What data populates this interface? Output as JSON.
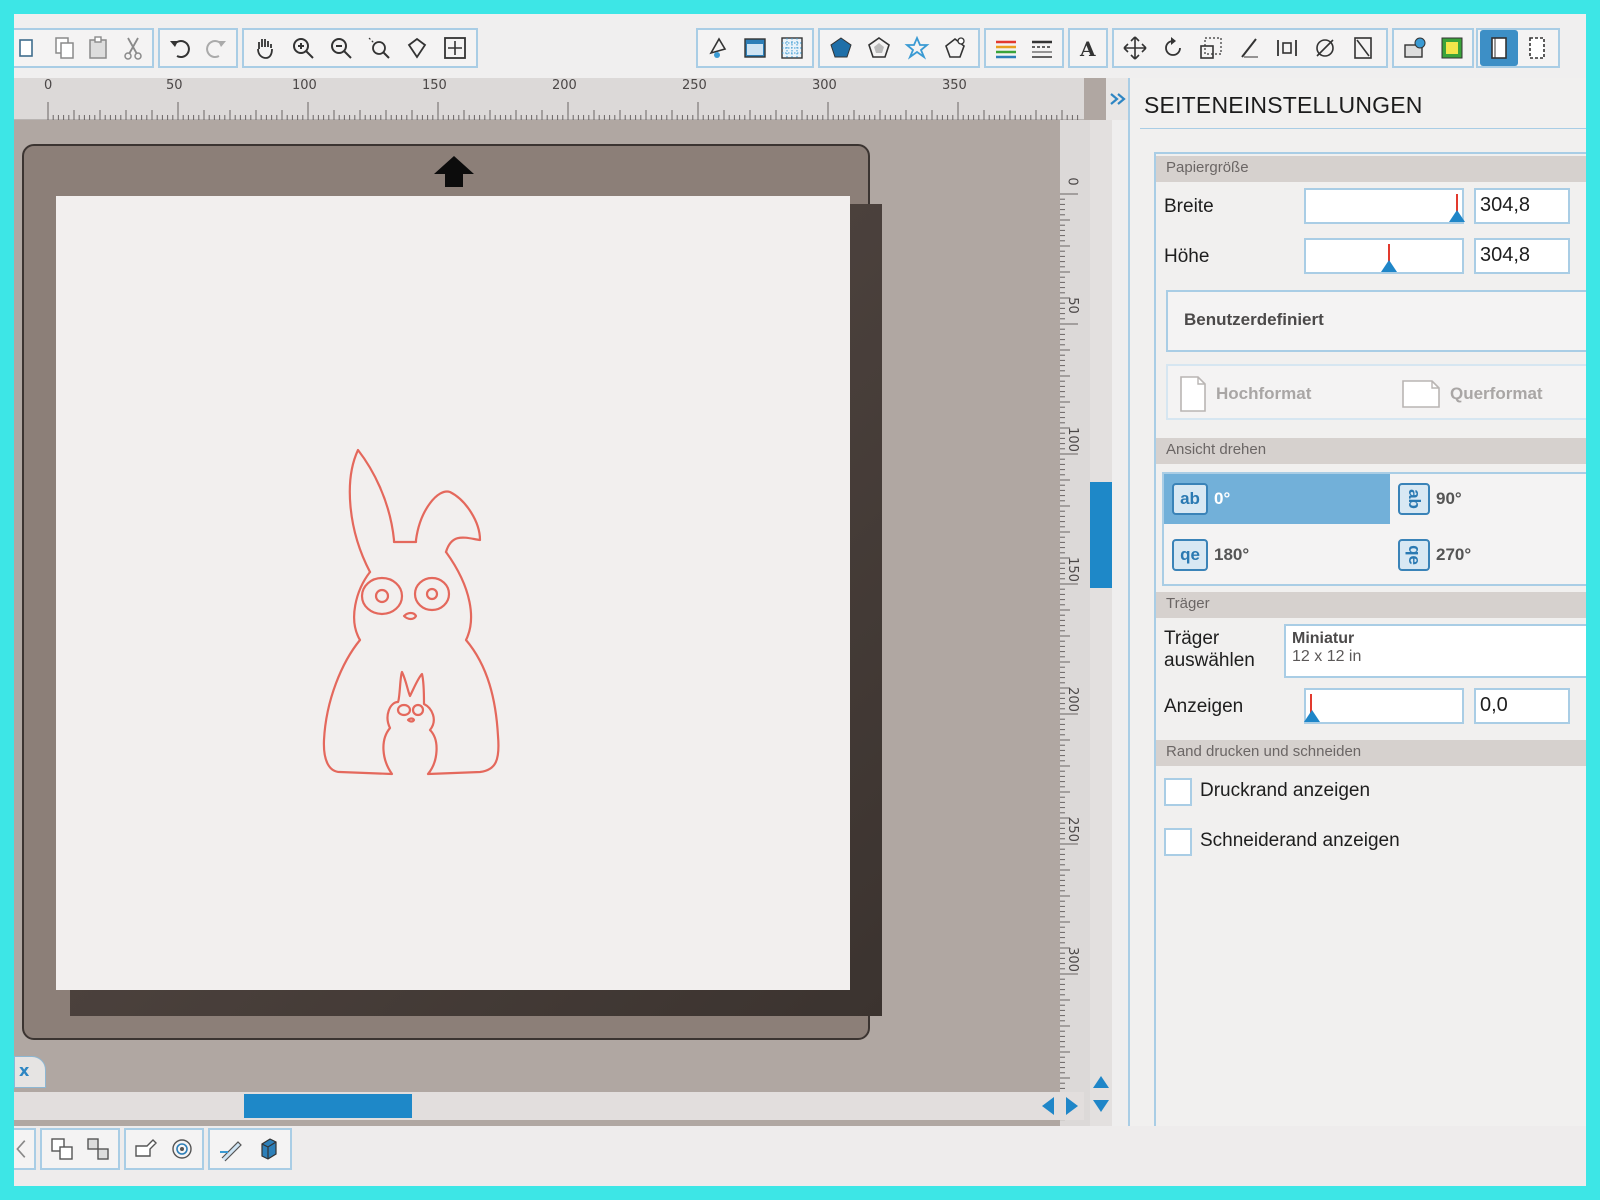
{
  "toolbar": {
    "icons": [
      "page-icon",
      "copy-icon",
      "paste-icon",
      "cut-icon",
      "undo-icon",
      "redo-icon",
      "pan-hand-icon",
      "zoom-in-icon",
      "zoom-out-icon",
      "zoom-select-icon",
      "zoom-drag-icon",
      "zoom-fit-icon",
      "fill-icon",
      "page-setup-icon",
      "grid-icon",
      "shape-pentagon-icon",
      "shape-fill-icon",
      "replicate-icon",
      "offset-icon",
      "line-color-icon",
      "line-style-icon",
      "text-icon",
      "move-icon",
      "rotate-icon",
      "scale-icon",
      "shear-icon",
      "align-icon",
      "modify-icon",
      "knife-icon",
      "store-icon",
      "print-cut-icon",
      "page-view-icon",
      "fullscreen-icon"
    ]
  },
  "ruler": {
    "h_labels": [
      "0",
      "50",
      "100",
      "150",
      "200",
      "250",
      "300",
      "350"
    ],
    "v_labels": [
      "0",
      "50",
      "100",
      "150",
      "200",
      "250",
      "300"
    ]
  },
  "tab": {
    "close_label": "x"
  },
  "panel": {
    "title": "SEITENEINSTELLUNGEN",
    "paper_size": {
      "header": "Papiergröße",
      "width_label": "Breite",
      "width_value": "304,8",
      "height_label": "Höhe",
      "height_value": "304,8",
      "preset": "Benutzerdefiniert",
      "portrait": "Hochformat",
      "landscape": "Querformat"
    },
    "rotate_view": {
      "header": "Ansicht drehen",
      "options": [
        {
          "icon": "ab",
          "label": "0°",
          "selected": true
        },
        {
          "icon": "ab",
          "label": "90°",
          "selected": false
        },
        {
          "icon": "qe",
          "label": "180°",
          "selected": false
        },
        {
          "icon": "qe",
          "label": "270°",
          "selected": false
        }
      ]
    },
    "carrier": {
      "header": "Träger",
      "select_label_1": "Träger",
      "select_label_2": "auswählen",
      "selected_name": "Miniatur",
      "selected_size": "12 x 12 in",
      "show_label": "Anzeigen",
      "show_value": "0,0"
    },
    "print_cut": {
      "header": "Rand drucken und schneiden",
      "show_print_border": "Druckrand anzeigen",
      "show_cut_border": "Schneiderand anzeigen"
    }
  },
  "colors": {
    "accent": "#1f86c8",
    "border": "#a9cde5",
    "bunny_stroke": "#e4685c",
    "mat": "#8c7f78",
    "frame": "#3de6e6"
  }
}
